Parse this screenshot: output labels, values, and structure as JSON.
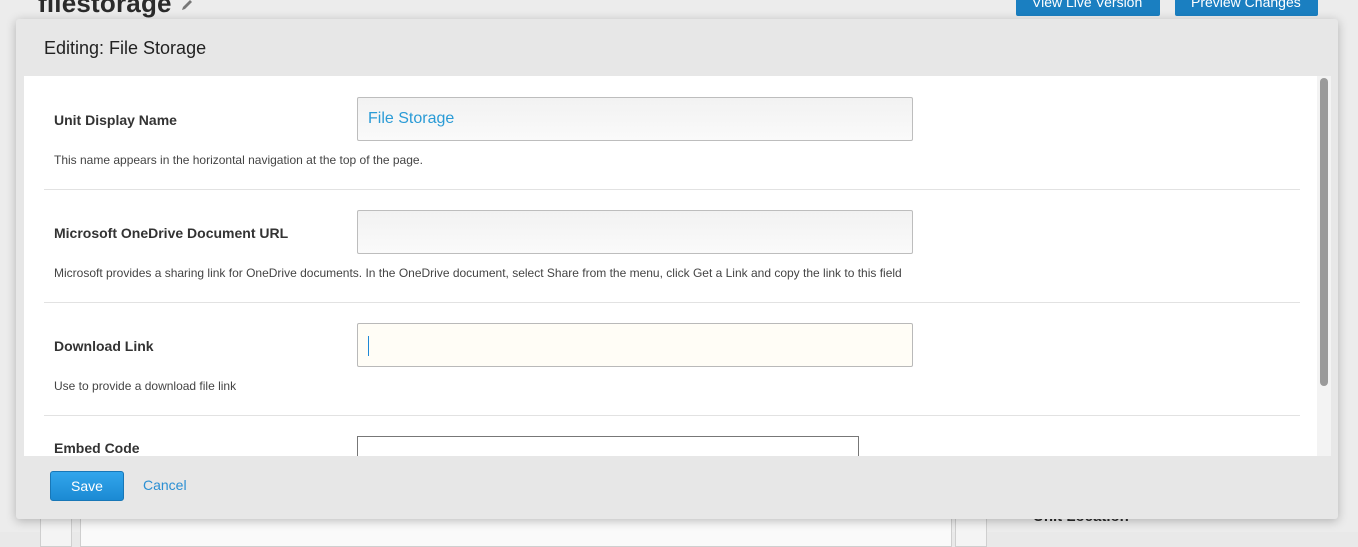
{
  "background": {
    "page_title": "filestorage",
    "buttons": {
      "view_live": "View Live Version",
      "preview": "Preview Changes"
    },
    "side_heading": "Unit Location"
  },
  "modal": {
    "title": "Editing: File Storage",
    "fields": [
      {
        "label": "Unit Display Name",
        "value": "File Storage",
        "help": "This name appears in the horizontal navigation at the top of the page."
      },
      {
        "label": "Microsoft OneDrive Document URL",
        "value": "",
        "help": "Microsoft provides a sharing link for OneDrive documents. In the OneDrive document, select Share from the menu, click Get a Link and copy the link to this field"
      },
      {
        "label": "Download Link",
        "value": "",
        "help": "Use to provide a download file link"
      },
      {
        "label": "Embed Code"
      }
    ],
    "footer": {
      "save": "Save",
      "cancel": "Cancel"
    }
  },
  "colors": {
    "accent": "#1b8ad3",
    "link": "#2b8fd3",
    "input_text": "#2a9bd6"
  },
  "icons": {
    "edit": "pencil-icon"
  }
}
